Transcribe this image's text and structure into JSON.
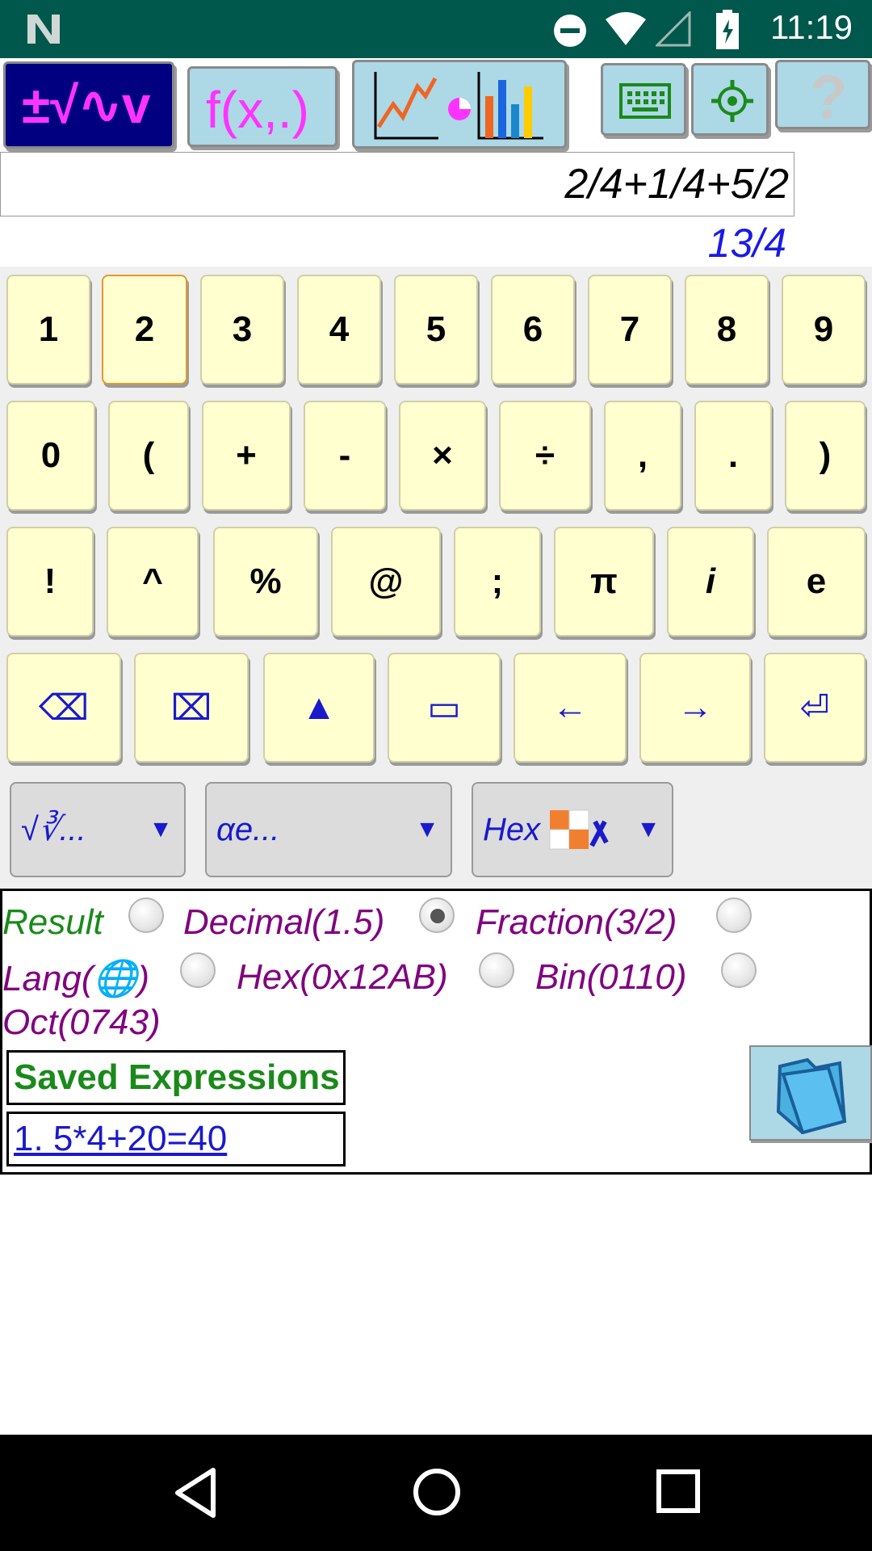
{
  "status_bar": {
    "time": "11:19",
    "icons": [
      "n-logo-icon",
      "do-not-disturb-icon",
      "wifi-icon",
      "signal-icon",
      "battery-charging-icon"
    ]
  },
  "toolbar": {
    "calc_mode_label": "±√∿v",
    "function_mode_label": "f(x,.)",
    "graph_mode_icon": "chart-icon",
    "keyboard_icon": "keyboard-icon",
    "settings_icon": "gear-icon",
    "help_label": "?"
  },
  "expression": {
    "value": "2/4+1/4+5/2",
    "result": "13/4"
  },
  "keypad": {
    "row1": [
      "1",
      "2",
      "3",
      "4",
      "5",
      "6",
      "7",
      "8",
      "9"
    ],
    "row2": [
      "0",
      "(",
      "+",
      "-",
      "×",
      "÷",
      ",",
      ".",
      ")"
    ],
    "row3": [
      "!",
      "^",
      "%",
      "@",
      ";",
      "π",
      "i",
      "e"
    ],
    "row4_icons": [
      "backspace-icon",
      "clear-icon",
      "shift-icon",
      "space-icon",
      "left-arrow-icon",
      "right-arrow-icon",
      "enter-icon"
    ],
    "row4_glyphs": [
      "⌫",
      "⌧",
      "▲",
      "▭",
      "←",
      "→",
      "⏎"
    ]
  },
  "dropdowns": [
    {
      "label": "√∛...",
      "arrow": "▼"
    },
    {
      "label": "αe...",
      "arrow": "▼"
    },
    {
      "label": "Hex",
      "arrow": "▼"
    }
  ],
  "result_options": {
    "result_label": "Result",
    "options": [
      {
        "label": "Decimal(1.5)",
        "selected": false
      },
      {
        "label": "Fraction(3/2)",
        "selected": true
      },
      {
        "label": "Lang(🌐)",
        "selected": false
      },
      {
        "label": "Hex(0x12AB)",
        "selected": false
      },
      {
        "label": "Bin(0110)",
        "selected": false
      },
      {
        "label": "Oct(0743)",
        "selected": false
      }
    ]
  },
  "saved": {
    "title": "Saved Expressions",
    "items": [
      "1. 5*4+20=40"
    ]
  },
  "colors": {
    "status_bar": "#00574b",
    "key_bg": "#ffffd0",
    "toolbar_bg": "#add8e6",
    "accent_blue": "#1a1acc",
    "option_purple": "#800080",
    "green": "#1a8a1a"
  }
}
